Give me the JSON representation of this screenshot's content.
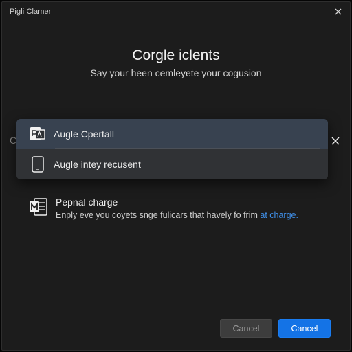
{
  "window": {
    "title": "Pigli Clamer",
    "close_icon": "close-icon"
  },
  "dialog": {
    "heading": "Corgle iclents",
    "subheading": "Say your heen cemleyete your cogusion",
    "hidden_glyph": "C"
  },
  "dropdown": {
    "items": [
      {
        "label": "Augle Cpertall",
        "icon": "app-document-icon"
      },
      {
        "label": "Augle intey recusent",
        "icon": "tablet-device-icon"
      }
    ],
    "close_icon": "close-icon"
  },
  "option": {
    "title": "Pepnal charge",
    "description_prefix": "Enply eve you coyets snge fulicars that havely fo frim ",
    "link_text": "at charge.",
    "icon": "office-document-icon"
  },
  "buttons": {
    "secondary_label": "Cancel",
    "primary_label": "Cancel"
  },
  "colors": {
    "accent": "#1473e6",
    "link": "#3f8fe8",
    "background": "#1c1c1c",
    "dropdown_selected": "#384250"
  }
}
